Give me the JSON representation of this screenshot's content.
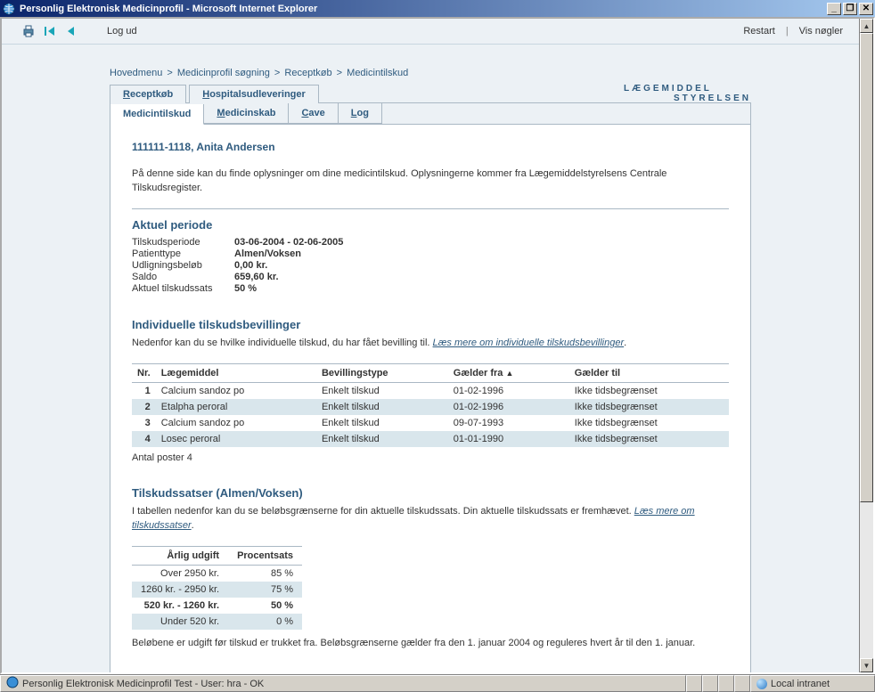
{
  "window": {
    "title": "Personlig Elektronisk Medicinprofil - Microsoft Internet Explorer"
  },
  "toolbar": {
    "logout": "Log ud",
    "restart": "Restart",
    "show_keys": "Vis nøgler"
  },
  "breadcrumb": {
    "items": [
      "Hovedmenu",
      "Medicinprofil søgning",
      "Receptkøb",
      "Medicintilskud"
    ]
  },
  "tabs_top": {
    "receptkob": "Receptkøb",
    "hospital": "Hospitalsudleveringer"
  },
  "tabs_sub": {
    "tilskud": "Medicintilskud",
    "medicinskab": "Medicinskab",
    "cave": "Cave",
    "log": "Log"
  },
  "logo": {
    "line1": "LÆGEMIDDEL",
    "line2": "STYRELSEN"
  },
  "patient": {
    "id_name": "111111-1118, Anita Andersen"
  },
  "intro": {
    "text": "På denne side kan du finde oplysninger om dine medicintilskud. Oplysningerne kommer fra Lægemiddelstyrelsens Centrale Tilskudsregister."
  },
  "current_period": {
    "heading": "Aktuel periode",
    "rows": {
      "period_label": "Tilskudsperiode",
      "period_value": "03-06-2004 - 02-06-2005",
      "patienttype_label": "Patienttype",
      "patienttype_value": "Almen/Voksen",
      "udlign_label": "Udligningsbeløb",
      "udlign_value": "0,00 kr.",
      "saldo_label": "Saldo",
      "saldo_value": "659,60 kr.",
      "rate_label": "Aktuel tilskudssats",
      "rate_value": "50 %"
    }
  },
  "grants": {
    "heading": "Individuelle tilskudsbevillinger",
    "intro_prefix": "Nedenfor kan du se hvilke individuelle tilskud, du har fået bevilling til. ",
    "intro_link": "Læs mere om individuelle tilskudsbevillinger",
    "columns": {
      "nr": "Nr.",
      "drug": "Lægemiddel",
      "type": "Bevillingstype",
      "from": "Gælder fra",
      "to": "Gælder til"
    },
    "rows": [
      {
        "nr": "1",
        "drug": "Calcium sandoz po",
        "type": "Enkelt tilskud",
        "from": "01-02-1996",
        "to": "Ikke tidsbegrænset"
      },
      {
        "nr": "2",
        "drug": "Etalpha peroral",
        "type": "Enkelt tilskud",
        "from": "01-02-1996",
        "to": "Ikke tidsbegrænset"
      },
      {
        "nr": "3",
        "drug": "Calcium sandoz po",
        "type": "Enkelt tilskud",
        "from": "09-07-1993",
        "to": "Ikke tidsbegrænset"
      },
      {
        "nr": "4",
        "drug": "Losec peroral",
        "type": "Enkelt tilskud",
        "from": "01-01-1990",
        "to": "Ikke tidsbegrænset"
      }
    ],
    "footer": "Antal poster 4"
  },
  "rates": {
    "heading": "Tilskudssatser (Almen/Voksen)",
    "intro_prefix": "I tabellen nedenfor kan du se beløbsgrænserne for din aktuelle tilskudssats. Din aktuelle tilskudssats er fremhævet. ",
    "intro_link": "Læs mere om tilskudssatser",
    "columns": {
      "amount": "Årlig udgift",
      "pct": "Procentsats"
    },
    "rows": [
      {
        "amount": "Over 2950 kr.",
        "pct": "85 %"
      },
      {
        "amount": "1260 kr. - 2950 kr.",
        "pct": "75 %"
      },
      {
        "amount": "520 kr. - 1260 kr.",
        "pct": "50 %",
        "highlight": true
      },
      {
        "amount": "Under 520 kr.",
        "pct": "0 %"
      }
    ],
    "footer": "Beløbene er udgift før tilskud er trukket fra. Beløbsgrænserne gælder fra den 1. januar 2004 og reguleres hvert år til den 1. januar."
  },
  "statusbar": {
    "text": "Personlig Elektronisk Medicinprofil Test - User: hra - OK",
    "zone": "Local intranet"
  },
  "chart_data": {
    "type": "table",
    "title": "Tilskudssatser (Almen/Voksen)",
    "columns": [
      "Årlig udgift (kr.)",
      "Procentsats (%)"
    ],
    "rows": [
      {
        "range": "Over 2950",
        "pct": 85
      },
      {
        "range": "1260 - 2950",
        "pct": 75
      },
      {
        "range": "520 - 1260",
        "pct": 50
      },
      {
        "range": "Under 520",
        "pct": 0
      }
    ],
    "highlight_row_index": 2
  }
}
